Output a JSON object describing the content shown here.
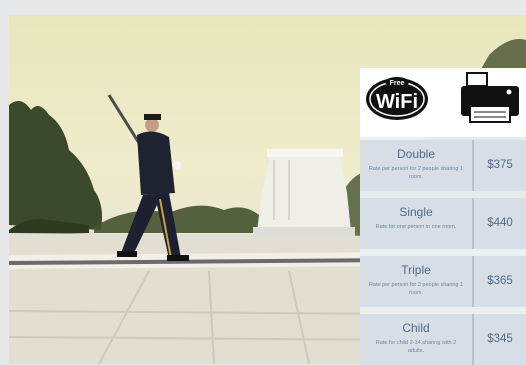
{
  "image": {
    "alt": "Guard in uniform marching with a rifle in front of a marble tomb under a hazy sky"
  },
  "amenities": [
    {
      "name": "wifi",
      "badge_text": "Free",
      "logo_text": "WiFi"
    },
    {
      "name": "printer"
    }
  ],
  "rates": [
    {
      "name": "Double",
      "description": "Rate per person for 2 people sharing 1 room.",
      "price": "$375"
    },
    {
      "name": "Single",
      "description": "Rate for one person in one room.",
      "price": "$440"
    },
    {
      "name": "Triple",
      "description": "Rate per person for 3 people sharing 1 room.",
      "price": "$365"
    },
    {
      "name": "Child",
      "description": "Rate for child 2-14 sharing with 2 adults.",
      "price": "$345"
    }
  ]
}
